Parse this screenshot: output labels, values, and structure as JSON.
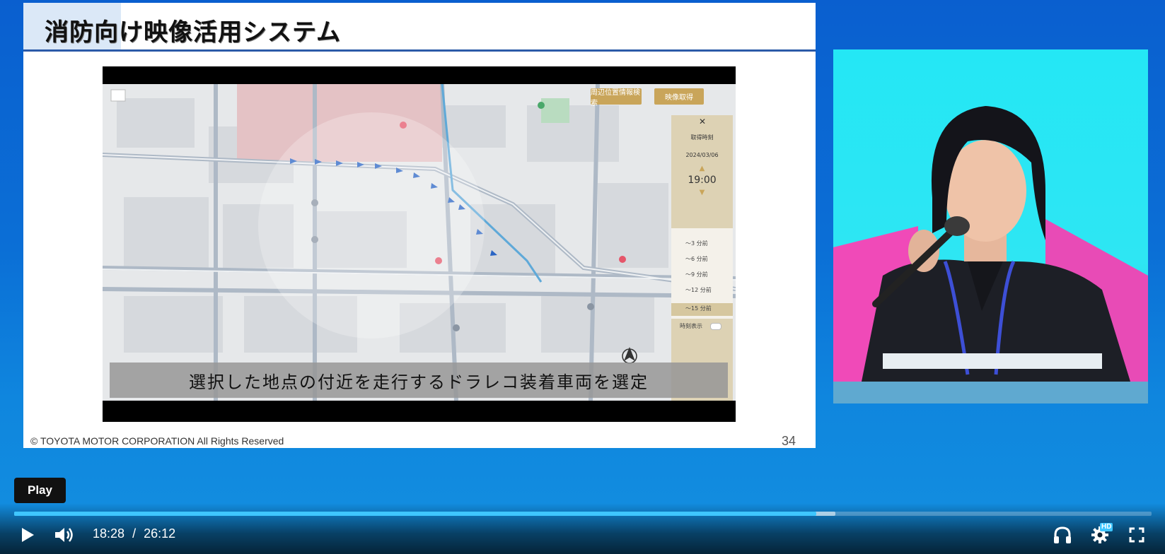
{
  "slide": {
    "title": "消防向け映像活用システム",
    "subtitle": "選択した地点の付近を走行するドラレコ装着車両を選定",
    "copyright": "© TOYOTA MOTOR CORPORATION All Rights Reserved",
    "page_number": "34",
    "map": {
      "button_nearby": "周辺位置情報検索",
      "button_video": "映像取得",
      "panel_title": "取得時刻",
      "panel_date": "2024/03/06",
      "panel_time": "19:00",
      "options": [
        "～3 分前",
        "～6 分前",
        "～9 分前",
        "～12 分前",
        "～15 分前"
      ],
      "selected_option": "～15 分前",
      "time_display_label": "時刻表示"
    }
  },
  "player": {
    "tooltip": "Play",
    "current_time": "18:28",
    "separator": "/",
    "duration": "26:12",
    "progress_fraction": 0.705,
    "buffered_fraction": 0.722,
    "hd_badge": "HD",
    "accent_color": "#3fc6ff",
    "icons": {
      "play": "play-icon",
      "volume": "volume-icon",
      "audio": "headphones-icon",
      "settings": "gear-icon",
      "fullscreen": "fullscreen-icon"
    }
  }
}
